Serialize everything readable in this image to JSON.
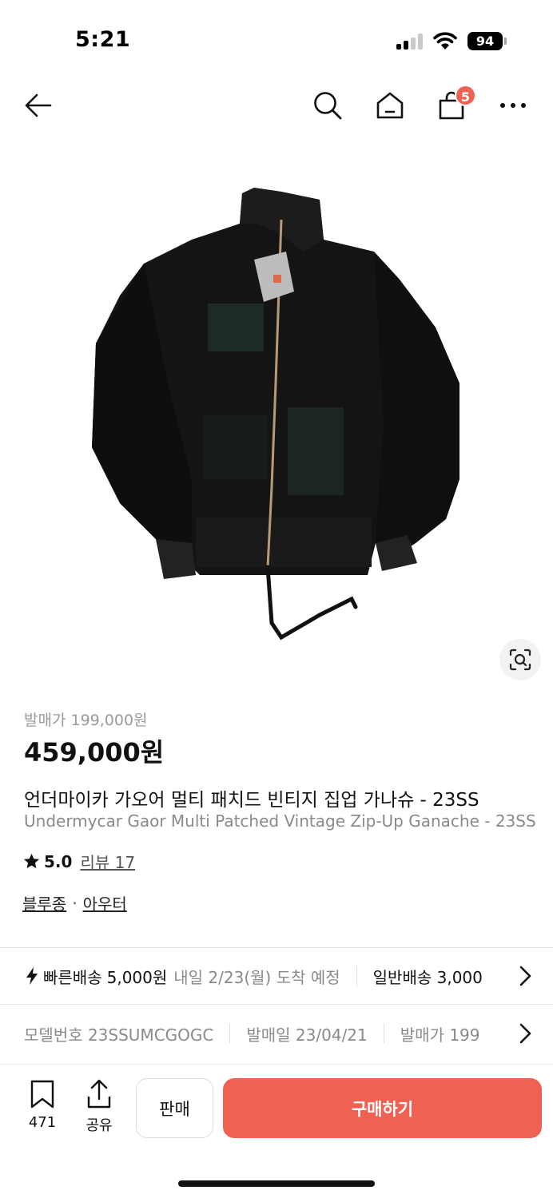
{
  "status_bar": {
    "time": "5:21",
    "battery": "94"
  },
  "header": {
    "cart_count": "5"
  },
  "product": {
    "release_price_label": "발매가 199,000원",
    "price": "459,000원",
    "title_ko": "언더마이카 가오어 멀티 패치드 빈티지 집업 가나슈 - 23SS",
    "title_en": "Undermycar Gaor Multi Patched Vintage Zip-Up Ganache - 23SS",
    "rating": "5.0",
    "review_link": "리뷰 17",
    "category_1": "블루종",
    "category_sep": "·",
    "category_2": "아우터"
  },
  "delivery": {
    "fast_label": "빠른배송",
    "fast_price": "5,000원",
    "fast_eta": "내일 2/23(월) 도착 예정",
    "normal_label": "일반배송 3,000"
  },
  "model_info": {
    "model_label": "모델번호 23SSUMCGOGC",
    "release_date_label": "발매일 23/04/21",
    "release_price_short": "발매가 199"
  },
  "bottom_bar": {
    "bookmark_count": "471",
    "share_label": "공유",
    "sell_label": "판매",
    "buy_label": "구매하기"
  },
  "colors": {
    "accent": "#ef6253",
    "text": "#111111",
    "muted": "#8a8a8a"
  }
}
